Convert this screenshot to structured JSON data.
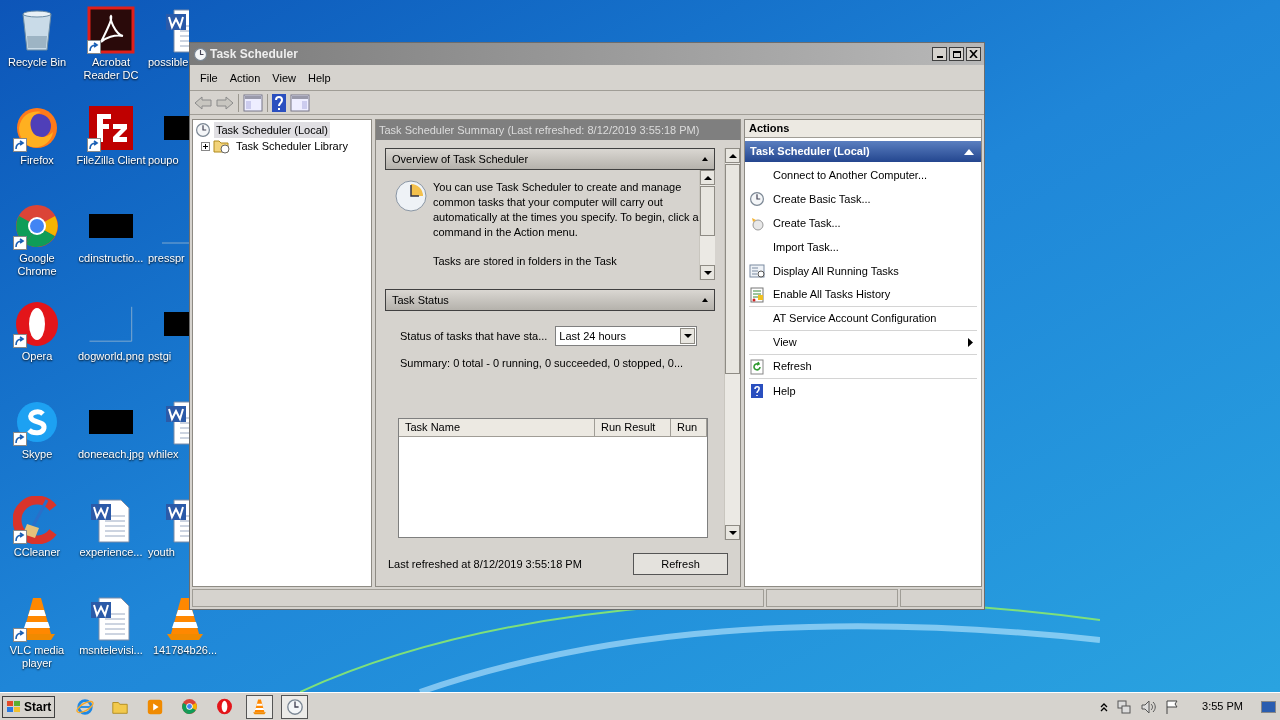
{
  "desktop_icons": [
    {
      "label": "Recycle Bin",
      "kind": "recycle",
      "shortcut": false
    },
    {
      "label": "Firefox",
      "kind": "firefox",
      "shortcut": true
    },
    {
      "label": "Google Chrome",
      "kind": "chrome",
      "shortcut": true
    },
    {
      "label": "Opera",
      "kind": "opera",
      "shortcut": true
    },
    {
      "label": "Skype",
      "kind": "skype",
      "shortcut": true
    },
    {
      "label": "CCleaner",
      "kind": "ccleaner",
      "shortcut": true
    },
    {
      "label": "VLC media player",
      "kind": "vlc",
      "shortcut": true
    },
    {
      "label": "Acrobat Reader DC",
      "kind": "pdf",
      "shortcut": true
    },
    {
      "label": "FileZilla Client",
      "kind": "filezilla",
      "shortcut": true
    },
    {
      "label": "cdinstructio...",
      "kind": "thumbnail",
      "shortcut": false
    },
    {
      "label": "dogworld.png",
      "kind": "blank",
      "shortcut": false
    },
    {
      "label": "doneeach.jpg",
      "kind": "thumbnail",
      "shortcut": false
    },
    {
      "label": "experience...",
      "kind": "word",
      "shortcut": false
    },
    {
      "label": "msntelevisi...",
      "kind": "word",
      "shortcut": false
    },
    {
      "label": "possible",
      "kind": "word",
      "shortcut": false
    },
    {
      "label": "poupo",
      "kind": "thumbnail",
      "shortcut": false
    },
    {
      "label": "presspr",
      "kind": "blank",
      "shortcut": false
    },
    {
      "label": "pstgi",
      "kind": "thumbnail",
      "shortcut": false
    },
    {
      "label": "whilex",
      "kind": "word",
      "shortcut": false
    },
    {
      "label": "youth",
      "kind": "word",
      "shortcut": false
    },
    {
      "label": "141784b26...",
      "kind": "vlc",
      "shortcut": false
    }
  ],
  "window": {
    "title": "Task Scheduler",
    "menu": [
      "File",
      "Action",
      "View",
      "Help"
    ],
    "tree": [
      {
        "label": "Task Scheduler (Local)",
        "selected": true,
        "children": [
          {
            "label": "Task Scheduler Library",
            "selected": false,
            "expanded": false
          }
        ]
      }
    ],
    "summary": {
      "header": "Task Scheduler Summary (Last refreshed: 8/12/2019 3:55:18 PM)",
      "overview": {
        "title": "Overview of Task Scheduler",
        "text": "You can use Task Scheduler to create and manage common tasks that your computer will carry out automatically at the times you specify. To begin, click a command in the Action menu.",
        "text_2": "Tasks are stored in folders in the Task"
      },
      "task_status": {
        "title": "Task Status",
        "filter_label": "Status of tasks that have sta...",
        "filter_value": "Last 24 hours",
        "summary": "Summary: 0 total - 0 running, 0 succeeded, 0 stopped, 0...",
        "columns": [
          "Task Name",
          "Run Result",
          "Run"
        ]
      },
      "footer": "Last refreshed at 8/12/2019 3:55:18 PM",
      "refresh_button": "Refresh"
    },
    "actions": {
      "header": "Actions",
      "group": "Task Scheduler (Local)",
      "items": [
        {
          "label": "Connect to Another Computer...",
          "kind": "none",
          "divider": false,
          "submenu": false
        },
        {
          "label": "Create Basic Task...",
          "kind": "basic",
          "divider": false,
          "submenu": false
        },
        {
          "label": "Create Task...",
          "kind": "task",
          "divider": false,
          "submenu": false
        },
        {
          "label": "Import Task...",
          "kind": "none",
          "divider": false,
          "submenu": false
        },
        {
          "label": "Display All Running Tasks",
          "kind": "running",
          "divider": false,
          "submenu": false
        },
        {
          "label": "Enable All Tasks History",
          "kind": "history",
          "divider": true,
          "submenu": false
        },
        {
          "label": "AT Service Account Configuration",
          "kind": "none",
          "divider": true,
          "submenu": false
        },
        {
          "label": "View",
          "kind": "none",
          "divider": true,
          "submenu": true
        },
        {
          "label": "Refresh",
          "kind": "refresh",
          "divider": true,
          "submenu": false
        },
        {
          "label": "Help",
          "kind": "help",
          "divider": false,
          "submenu": false
        }
      ]
    }
  },
  "taskbar": {
    "start": "Start",
    "apps": [
      {
        "kind": "ie",
        "active": false
      },
      {
        "kind": "folder",
        "active": false
      },
      {
        "kind": "media",
        "active": false
      },
      {
        "kind": "chrome",
        "active": false
      },
      {
        "kind": "opera",
        "active": false
      },
      {
        "kind": "vlc",
        "active": true
      },
      {
        "kind": "clock",
        "active": true
      }
    ],
    "time": "3:55 PM"
  }
}
